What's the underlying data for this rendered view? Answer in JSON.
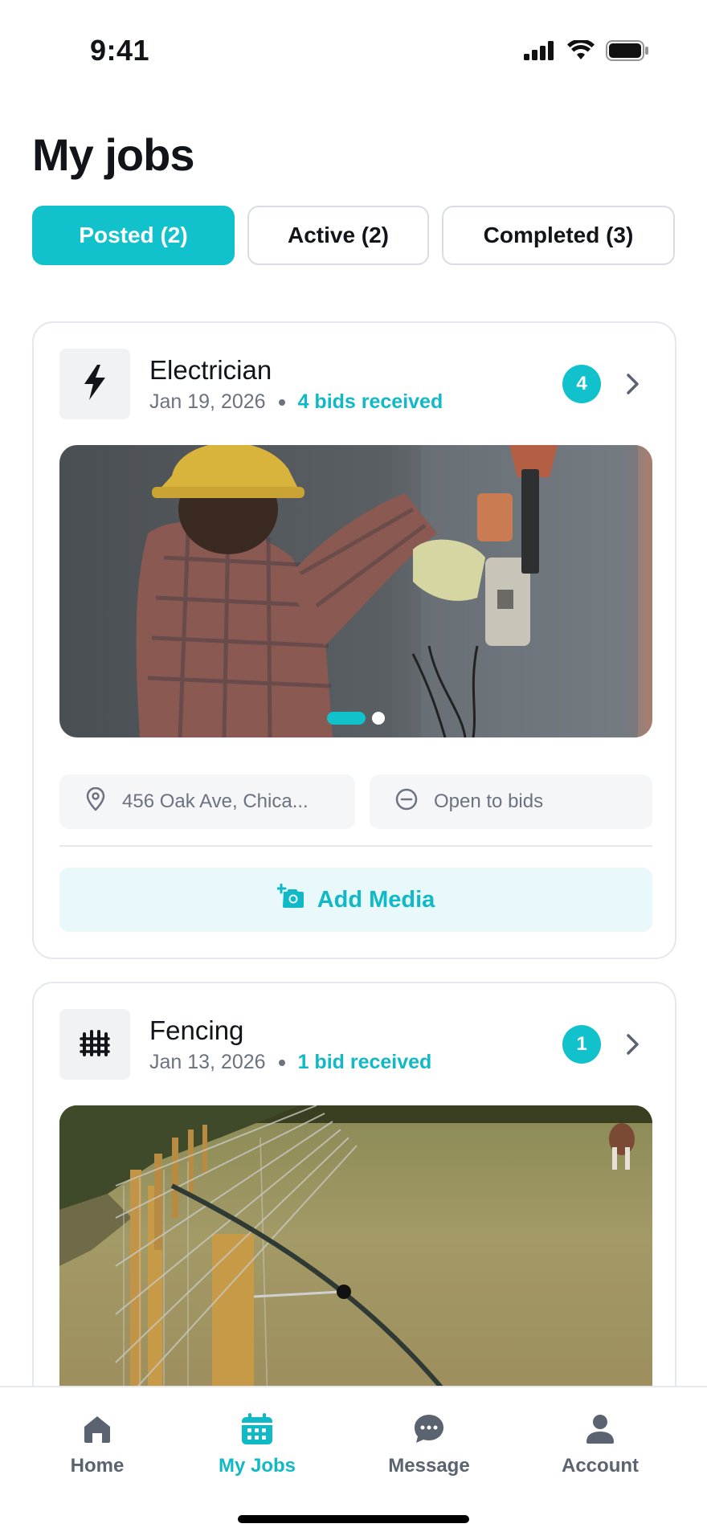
{
  "status_bar": {
    "time": "9:41"
  },
  "page": {
    "title": "My jobs"
  },
  "tabs": [
    {
      "label": "Posted (2)",
      "active": true
    },
    {
      "label": "Active (2)",
      "active": false
    },
    {
      "label": "Completed (3)",
      "active": false
    }
  ],
  "jobs": [
    {
      "title": "Electrician",
      "icon": "lightning-bolt-icon",
      "date": "Jan 19, 2026",
      "bids_text": "4 bids received",
      "bid_count": "4",
      "photo": "electrician-working-on-meter-photo",
      "photo_pages": 2,
      "photo_current_page": 1,
      "location": "456 Oak Ave, Chica...",
      "status": "Open to bids",
      "add_media_label": "Add Media"
    },
    {
      "title": "Fencing",
      "icon": "fence-icon",
      "date": "Jan 13, 2026",
      "bids_text": "1 bid received",
      "bid_count": "1",
      "photo": "wire-fence-pasture-photo"
    }
  ],
  "bottom_nav": [
    {
      "label": "Home",
      "icon": "home-icon",
      "active": false
    },
    {
      "label": "My Jobs",
      "icon": "calendar-icon",
      "active": true
    },
    {
      "label": "Message",
      "icon": "chat-bubble-icon",
      "active": false
    },
    {
      "label": "Account",
      "icon": "person-icon",
      "active": false
    }
  ],
  "colors": {
    "accent": "#11c1cc",
    "accent_text": "#11b9c6",
    "accent_light_bg": "#e8f8fb",
    "muted_text": "#6b7280",
    "chip_bg": "#f5f6f8"
  }
}
